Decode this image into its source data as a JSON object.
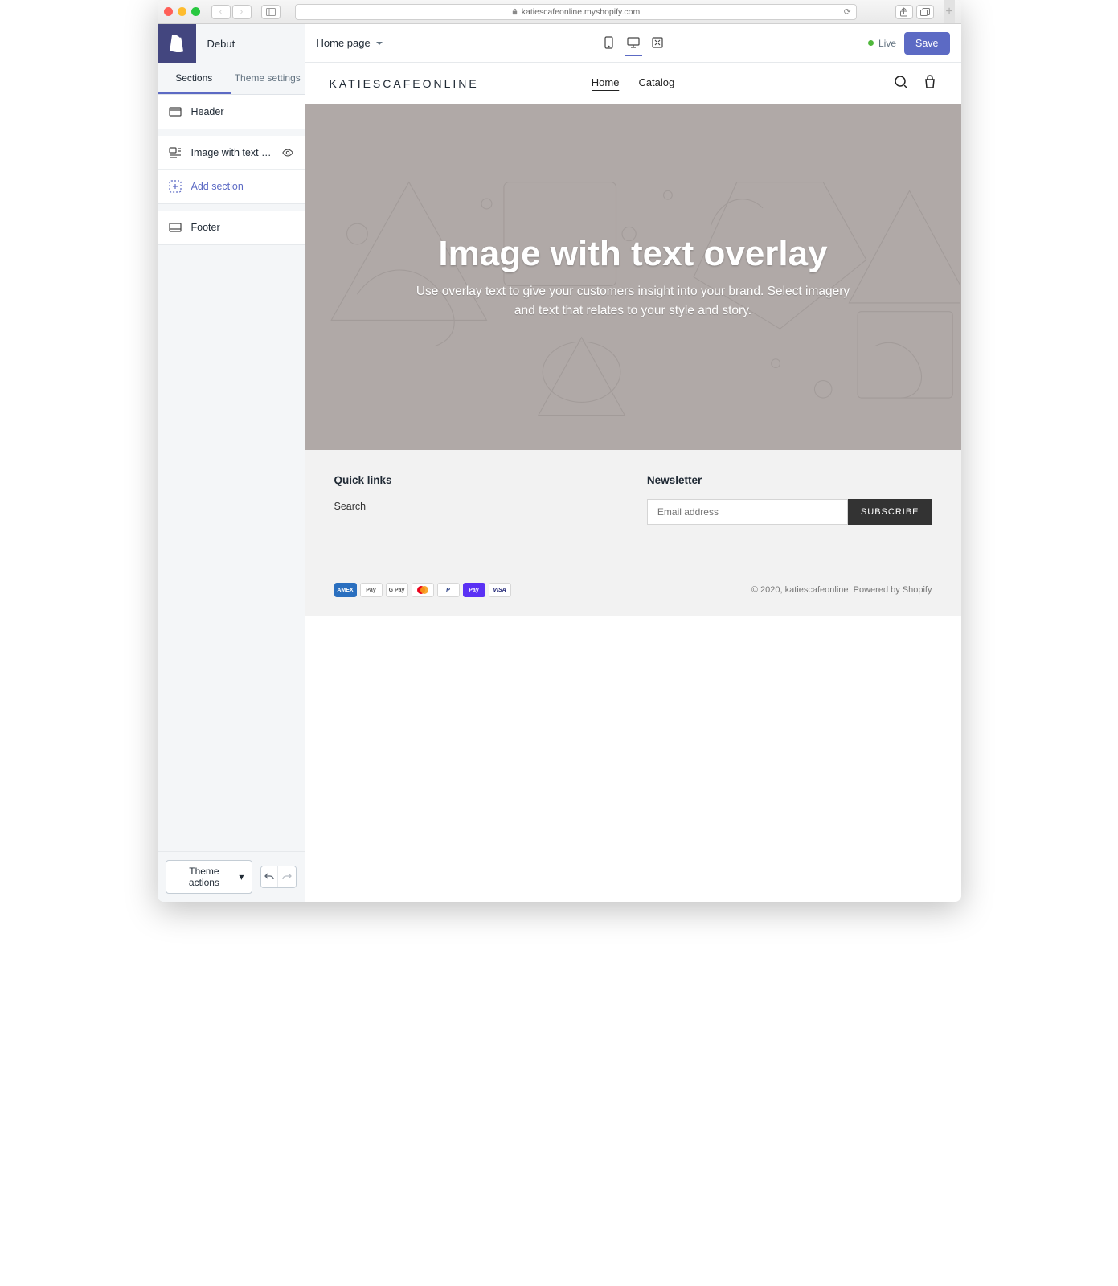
{
  "browser": {
    "url": "katiescafeonline.myshopify.com"
  },
  "sidebar": {
    "theme_name": "Debut",
    "tabs": {
      "sections": "Sections",
      "settings": "Theme settings"
    },
    "rows": {
      "header": "Header",
      "hero": "Image with text ov...",
      "add": "Add section",
      "footer": "Footer"
    },
    "theme_actions": "Theme actions"
  },
  "topbar": {
    "page": "Home page",
    "live": "Live",
    "save": "Save"
  },
  "store": {
    "name": "KATIESCAFEONLINE",
    "nav": {
      "home": "Home",
      "catalog": "Catalog"
    }
  },
  "hero": {
    "title": "Image with text overlay",
    "subtitle": "Use overlay text to give your customers insight into your brand. Select imagery and text that relates to your style and story."
  },
  "footer": {
    "quick_title": "Quick links",
    "quick_search": "Search",
    "news_title": "Newsletter",
    "email_placeholder": "Email address",
    "subscribe": "SUBSCRIBE",
    "cards": {
      "amex": "AMEX",
      "apple": "Pay",
      "gpay": "G Pay",
      "mc": "",
      "pp": "P",
      "shop": "Pay",
      "visa": "VISA"
    },
    "copyright": "© 2020, katiescafeonline",
    "powered": "Powered by Shopify"
  }
}
